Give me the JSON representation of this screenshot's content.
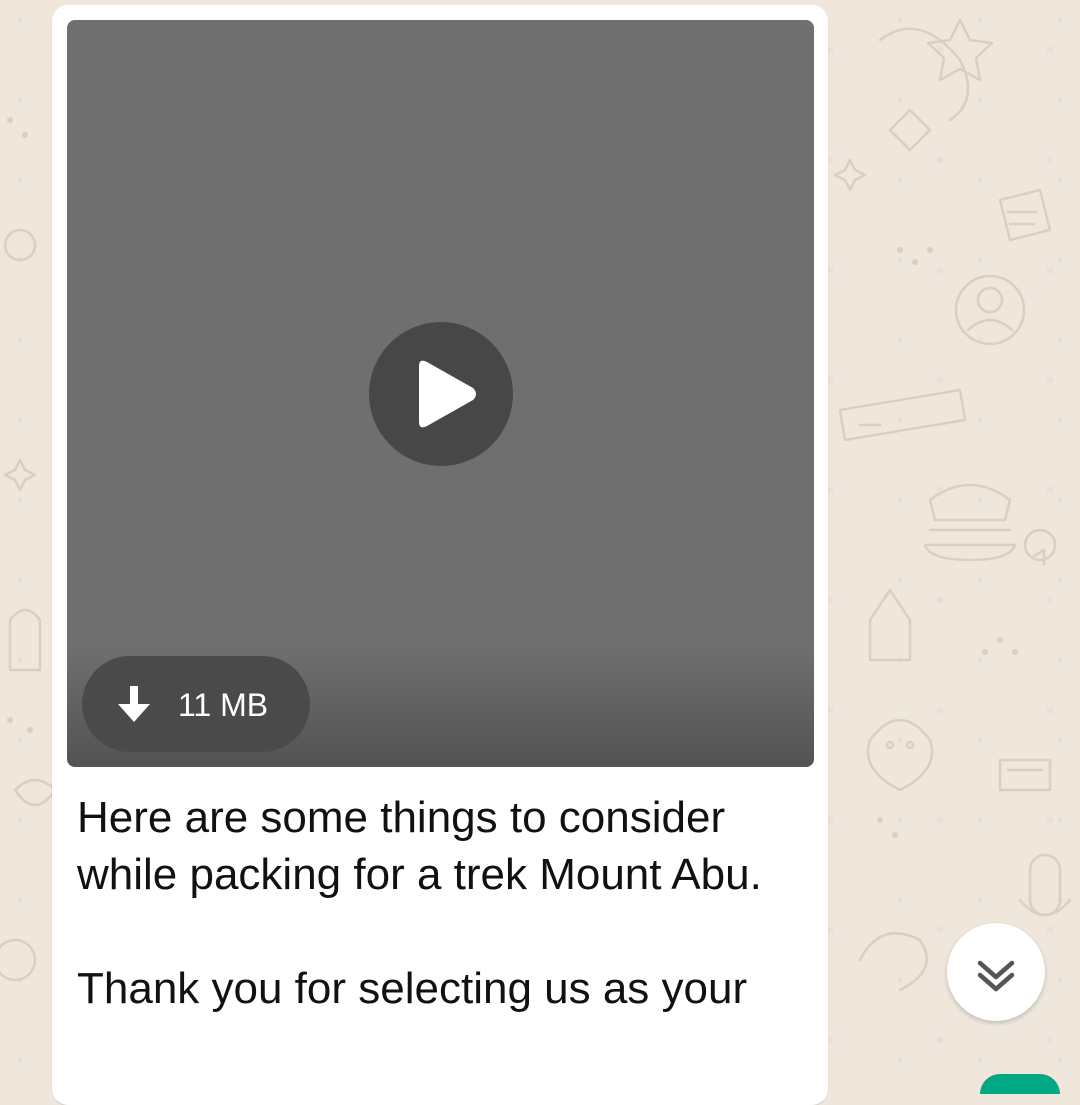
{
  "message": {
    "video": {
      "size_label": "11 MB",
      "play_icon": "play-icon",
      "download_icon": "download-arrow-icon"
    },
    "caption_lines": [
      "Here are some things to consider while packing for a trek Mount Abu.",
      "Thank you for selecting us as your"
    ]
  },
  "scroll_button": {
    "icon": "double-chevron-down-icon"
  },
  "colors": {
    "chat_background": "#efe7dc",
    "bubble": "#ffffff",
    "video_placeholder": "#6f6f6f",
    "accent": "#00a884"
  }
}
